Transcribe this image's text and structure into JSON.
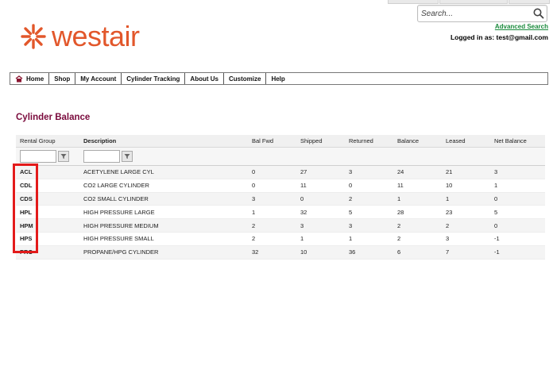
{
  "header": {
    "brand": "westair",
    "search_placeholder": "Search...",
    "advanced_search": "Advanced Search",
    "logged_in": "Logged in as: test@gmail.com"
  },
  "nav": {
    "items": [
      "Home",
      "Shop",
      "My Account",
      "Cylinder Tracking",
      "About Us",
      "Customize",
      "Help"
    ]
  },
  "page": {
    "title": "Cylinder Balance"
  },
  "table": {
    "columns": [
      "Rental Group",
      "Description",
      "Bal Fwd",
      "Shipped",
      "Returned",
      "Balance",
      "Leased",
      "Net Balance"
    ],
    "rows": [
      [
        "ACL",
        "ACETYLENE LARGE CYL",
        "0",
        "27",
        "3",
        "24",
        "21",
        "3"
      ],
      [
        "CDL",
        "CO2 LARGE CYLINDER",
        "0",
        "11",
        "0",
        "11",
        "10",
        "1"
      ],
      [
        "CDS",
        "CO2 SMALL CYLINDER",
        "3",
        "0",
        "2",
        "1",
        "1",
        "0"
      ],
      [
        "HPL",
        "HIGH PRESSURE LARGE",
        "1",
        "32",
        "5",
        "28",
        "23",
        "5"
      ],
      [
        "HPM",
        "HIGH PRESSURE MEDIUM",
        "2",
        "3",
        "3",
        "2",
        "2",
        "0"
      ],
      [
        "HPS",
        "HIGH PRESSURE SMALL",
        "2",
        "1",
        "1",
        "2",
        "3",
        "-1"
      ],
      [
        "PRO",
        "PROPANE/HPG CYLINDER",
        "32",
        "10",
        "36",
        "6",
        "7",
        "-1"
      ]
    ]
  },
  "colors": {
    "brand": "#e2572b",
    "title": "#7a0a3c",
    "highlight": "#e31b1b",
    "link": "#1a8a3c"
  }
}
